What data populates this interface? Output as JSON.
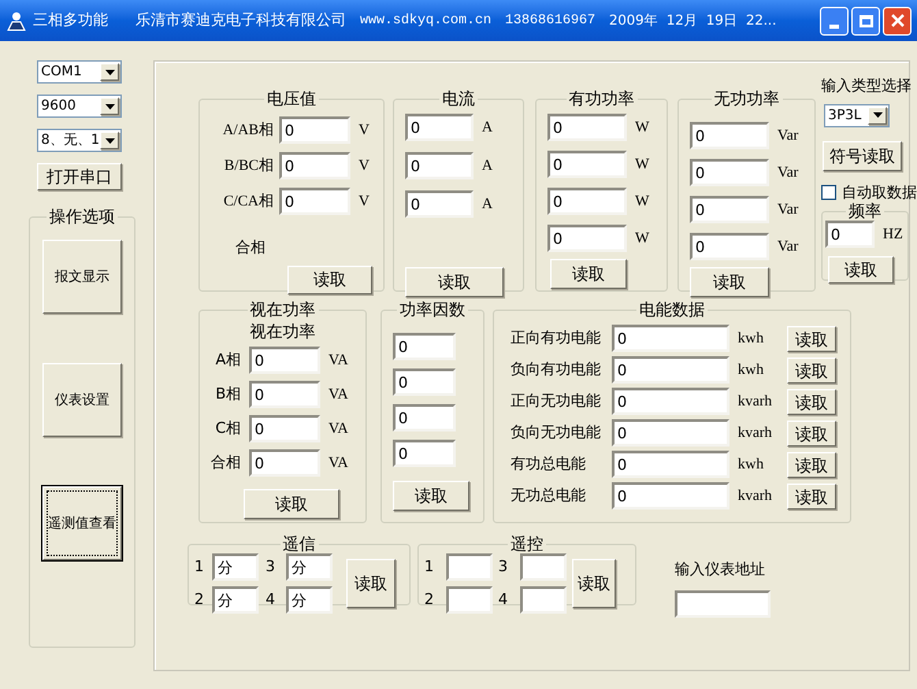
{
  "window": {
    "title": "三相多功能",
    "company": "乐清市赛迪克电子科技有限公司",
    "website": "www.sdkyq.com.cn",
    "phone": "13868616967",
    "datetime": "2009年  12月  19日  22..."
  },
  "serial": {
    "port": "COM1",
    "baud": "9600",
    "format": "8、无、1",
    "open_button": "打开串口"
  },
  "operations": {
    "title": "操作选项",
    "buttons": [
      {
        "label": "报文显示",
        "selected": false
      },
      {
        "label": "仪表设置",
        "selected": false
      },
      {
        "label": "遥测值查看",
        "selected": true
      }
    ]
  },
  "voltage": {
    "title": "电压值",
    "rows": [
      {
        "label": "A/AB相",
        "value": "0",
        "unit": "V"
      },
      {
        "label": "B/BC相",
        "value": "0",
        "unit": "V"
      },
      {
        "label": "C/CA相",
        "value": "0",
        "unit": "V"
      }
    ],
    "sum_label": "合相",
    "button": "读取"
  },
  "current": {
    "title": "电流",
    "rows": [
      {
        "value": "0",
        "unit": "A"
      },
      {
        "value": "0",
        "unit": "A"
      },
      {
        "value": "0",
        "unit": "A"
      }
    ],
    "button": "读取"
  },
  "active_power": {
    "title": "有功功率",
    "rows": [
      {
        "value": "0",
        "unit": "W"
      },
      {
        "value": "0",
        "unit": "W"
      },
      {
        "value": "0",
        "unit": "W"
      },
      {
        "value": "0",
        "unit": "W"
      }
    ],
    "button": "读取"
  },
  "reactive_power": {
    "title": "无功功率",
    "rows": [
      {
        "value": "0",
        "unit": "Var"
      },
      {
        "value": "0",
        "unit": "Var"
      },
      {
        "value": "0",
        "unit": "Var"
      },
      {
        "value": "0",
        "unit": "Var"
      }
    ],
    "button": "读取"
  },
  "input_type": {
    "label": "输入类型选择",
    "value": "3P3L",
    "sign_button": "符号读取",
    "auto_fetch": {
      "label": "自动取数据",
      "checked": false
    },
    "frequency": {
      "title": "频率",
      "value": "0",
      "unit": "HZ",
      "button": "读取"
    }
  },
  "apparent_power": {
    "title": "视在功率",
    "subtitle": "视在功率",
    "rows": [
      {
        "label": "A相",
        "value": "0",
        "unit": "VA"
      },
      {
        "label": "B相",
        "value": "0",
        "unit": "VA"
      },
      {
        "label": "C相",
        "value": "0",
        "unit": "VA"
      },
      {
        "label": "合相",
        "value": "0",
        "unit": "VA"
      }
    ],
    "button": "读取"
  },
  "power_factor": {
    "title": "功率因数",
    "values": [
      "0",
      "0",
      "0",
      "0"
    ],
    "button": "读取"
  },
  "energy": {
    "title": "电能数据",
    "rows": [
      {
        "label": "正向有功电能",
        "value": "0",
        "unit": "kwh",
        "button": "读取"
      },
      {
        "label": "负向有功电能",
        "value": "0",
        "unit": "kwh",
        "button": "读取"
      },
      {
        "label": "正向无功电能",
        "value": "0",
        "unit": "kvarh",
        "button": "读取"
      },
      {
        "label": "负向无功电能",
        "value": "0",
        "unit": "kvarh",
        "button": "读取"
      },
      {
        "label": "有功总电能",
        "value": "0",
        "unit": "kwh",
        "button": "读取"
      },
      {
        "label": "无功总电能",
        "value": "0",
        "unit": "kvarh",
        "button": "读取"
      }
    ]
  },
  "telesignal": {
    "title": "遥信",
    "items": [
      {
        "index": "1",
        "value": "分"
      },
      {
        "index": "3",
        "value": "分"
      },
      {
        "index": "2",
        "value": "分"
      },
      {
        "index": "4",
        "value": "分"
      }
    ],
    "button": "读取"
  },
  "telecontrol": {
    "title": "遥控",
    "items": [
      {
        "index": "1"
      },
      {
        "index": "3"
      },
      {
        "index": "2"
      },
      {
        "index": "4"
      }
    ],
    "button": "读取"
  },
  "address": {
    "label": "输入仪表地址"
  }
}
